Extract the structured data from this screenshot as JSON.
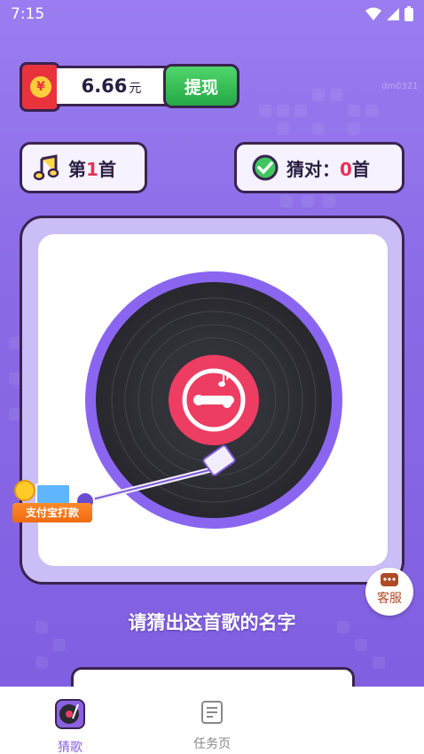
{
  "status_bar": {
    "time": "7:15"
  },
  "wallet": {
    "amount": "6.66",
    "unit": "元",
    "withdraw_label": "提现",
    "coin_symbol": "¥"
  },
  "song_counter": {
    "prefix": "第",
    "number": "1",
    "suffix": "首"
  },
  "correct_counter": {
    "prefix": "猜对：",
    "number": "0",
    "suffix": "首"
  },
  "alipay_badge": {
    "label": "支付宝打款"
  },
  "service": {
    "label": "客服"
  },
  "prompt": {
    "text": "请猜出这首歌的名字"
  },
  "tabs": [
    {
      "label": "猜歌",
      "icon": "turntable-icon",
      "active": true
    },
    {
      "label": "任务页",
      "icon": "document-icon",
      "active": false
    }
  ],
  "watermark": "dm0321",
  "colors": {
    "accent": "#8a62e0",
    "red": "#e8335a",
    "withdraw_green": "#25a845",
    "background": "#8c6ee8"
  }
}
